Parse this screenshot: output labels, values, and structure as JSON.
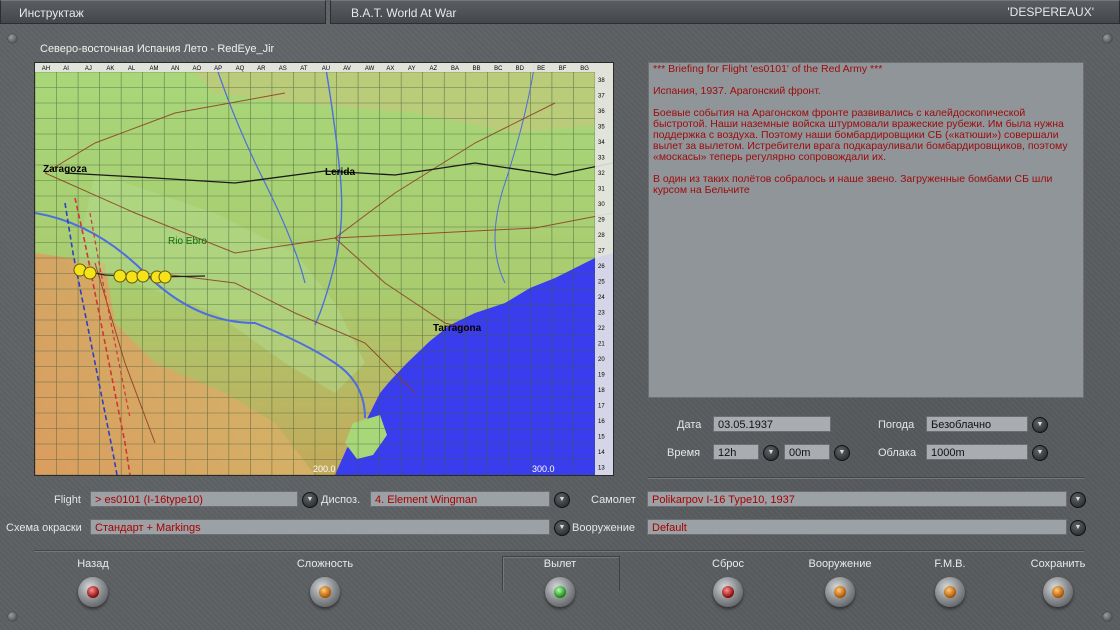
{
  "topbar": {
    "left_title": "Инструктаж",
    "center_title": "B.A.T. World At War",
    "right_title": "'DESPEREAUX'"
  },
  "map": {
    "title": "Северо-восточная Испания Лето - RedEye_Jir",
    "columns": [
      "AH",
      "AI",
      "AJ",
      "AK",
      "AL",
      "AM",
      "AN",
      "AO",
      "AP",
      "AQ",
      "AR",
      "AS",
      "AT",
      "AU",
      "AV",
      "AW",
      "AX",
      "AY",
      "AZ",
      "BA",
      "BB",
      "BC",
      "BD",
      "BE",
      "BF",
      "BG"
    ],
    "rows": [
      "38",
      "37",
      "36",
      "35",
      "34",
      "33",
      "32",
      "31",
      "30",
      "29",
      "28",
      "27",
      "26",
      "25",
      "24",
      "23",
      "22",
      "21",
      "20",
      "19",
      "18",
      "17",
      "16",
      "15",
      "14",
      "13"
    ],
    "cities": {
      "zaragoza": "Zaragoza",
      "lerida": "Lerida",
      "tarragona": "Tarragona",
      "rio_ebro": "Rio Ebro"
    },
    "scale_labels": [
      "200.0",
      "300.0"
    ]
  },
  "briefing": {
    "header": "*** Briefing for Flight 'es0101' of the Red Army ***",
    "line1": "Испания, 1937. Арагонский фронт.",
    "para1": "Боевые события на Арагонском фронте развивались с калейдоскопической быстротой. Наши наземные войска штурмовали вражеские рубежи. Им была нужна поддержка с воздуха. Поэтому наши бомбардировщики СБ («катюши») совершали вылет за вылетом. Истребители врага подкарауливали бомбардировщиков, поэтому «москасы» теперь регулярно сопровождали их.",
    "para2": "В один из таких полётов собралось и наше звено. Загруженные бомбами СБ шли курсом на Бельчите"
  },
  "mission": {
    "date_label": "Дата",
    "date_value": "03.05.1937",
    "weather_label": "Погода",
    "weather_value": "Безоблачно",
    "time_label": "Время",
    "time_hours": "12h",
    "time_minutes": "00m",
    "clouds_label": "Облака",
    "clouds_value": "1000m"
  },
  "flight": {
    "flight_label": "Flight",
    "flight_value": "> es0101 (I-16type10)",
    "dispos_label": "Диспоз.",
    "dispos_value": "4. Element Wingman",
    "plane_label": "Самолет",
    "plane_value": "Polikarpov I-16 Type10, 1937",
    "skin_label": "Схема окраски",
    "skin_value": "Стандарт + Markings",
    "weapons_label": "Вооружение",
    "weapons_value": "Default"
  },
  "buttons": {
    "back": "Назад",
    "difficulty": "Сложность",
    "fly": "Вылет",
    "reset": "Сброс",
    "loadout": "Вооружение",
    "fmb": "F.M.B.",
    "save": "Сохранить"
  },
  "colors": {
    "briefing_text": "#9c0b0b",
    "sea": "#3a3dee",
    "land": "#9ccf6a",
    "lamp_red": "#8e0f0f",
    "lamp_orange": "#b45a00",
    "lamp_green": "#1c8c18"
  }
}
